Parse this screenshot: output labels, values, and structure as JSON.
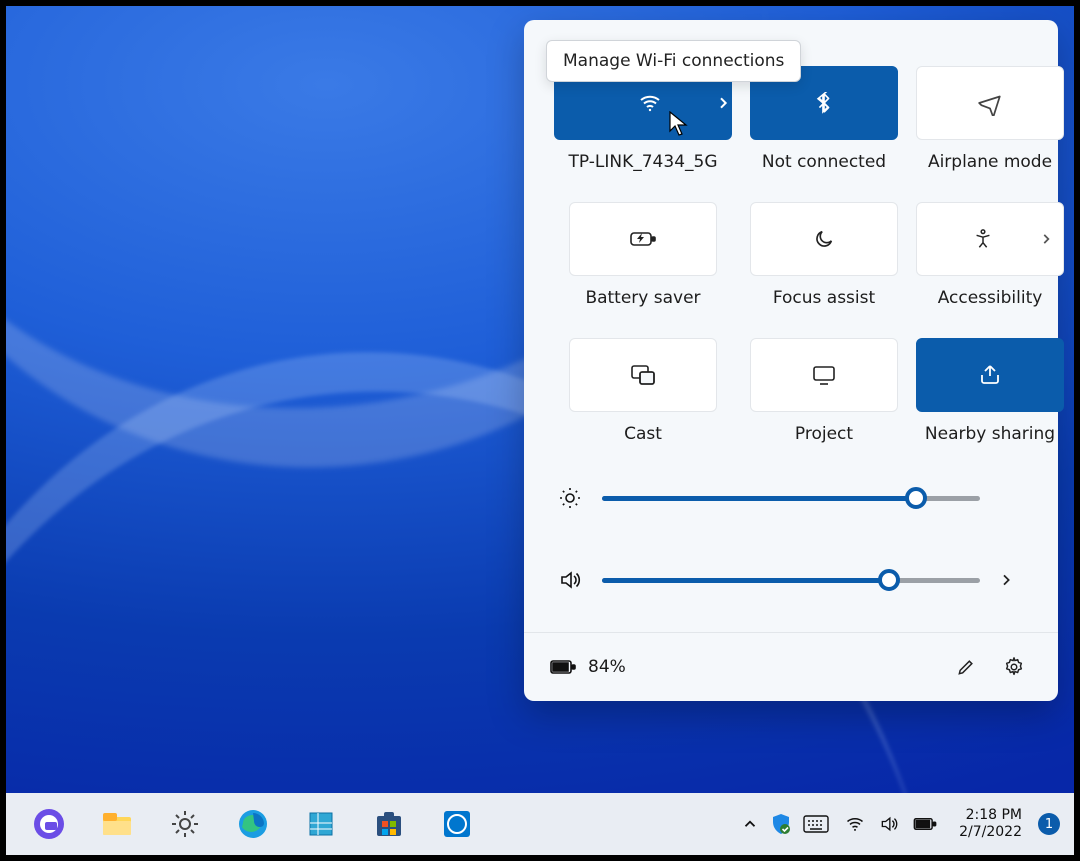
{
  "tooltip": "Manage Wi-Fi connections",
  "tiles": {
    "wifi": {
      "label": "TP-LINK_7434_5G"
    },
    "bt": {
      "label": "Not connected"
    },
    "plane": {
      "label": "Airplane mode"
    },
    "batt": {
      "label": "Battery saver"
    },
    "focus": {
      "label": "Focus assist"
    },
    "access": {
      "label": "Accessibility"
    },
    "cast": {
      "label": "Cast"
    },
    "project": {
      "label": "Project"
    },
    "nearby": {
      "label": "Nearby sharing"
    }
  },
  "sliders": {
    "brightness": 83,
    "volume": 76
  },
  "footer": {
    "battery_pct": "84%"
  },
  "taskbar": {
    "time": "2:18 PM",
    "date": "2/7/2022",
    "notif_count": "1"
  }
}
